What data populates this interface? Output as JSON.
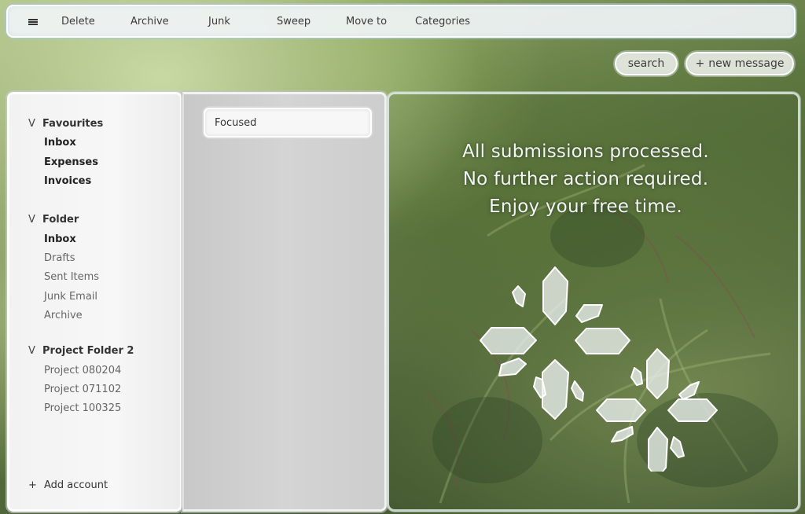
{
  "toolbar": {
    "menu_icon": "hamburger-icon",
    "items": [
      "Delete",
      "Archive",
      "Junk",
      "Sweep",
      "Move to",
      "Categories"
    ]
  },
  "actions": {
    "search_label": "search",
    "new_message_label": "new message",
    "new_message_icon": "plus-icon"
  },
  "sidebar": {
    "groups": [
      {
        "title": "Favourites",
        "items": [
          {
            "label": "Inbox"
          },
          {
            "label": "Expenses"
          },
          {
            "label": "Invoices"
          }
        ]
      },
      {
        "title": "Folder",
        "items": [
          {
            "label": "Inbox"
          },
          {
            "label": "Drafts"
          },
          {
            "label": "Sent Items"
          },
          {
            "label": "Junk Email"
          },
          {
            "label": "Archive"
          }
        ]
      },
      {
        "title": "Project Folder 2",
        "items": [
          {
            "label": "Project 080204"
          },
          {
            "label": "Project 071102"
          },
          {
            "label": "Project 100325"
          }
        ]
      }
    ],
    "chevron_glyph": "V",
    "add_account_icon": "+",
    "add_account_label": "Add account"
  },
  "message_list": {
    "tab_label": "Focused"
  },
  "reading_pane": {
    "lines": [
      "All submissions processed.",
      "No further action required.",
      "Enjoy your free time."
    ],
    "illustration": "crystal-cluster-illustration"
  }
}
